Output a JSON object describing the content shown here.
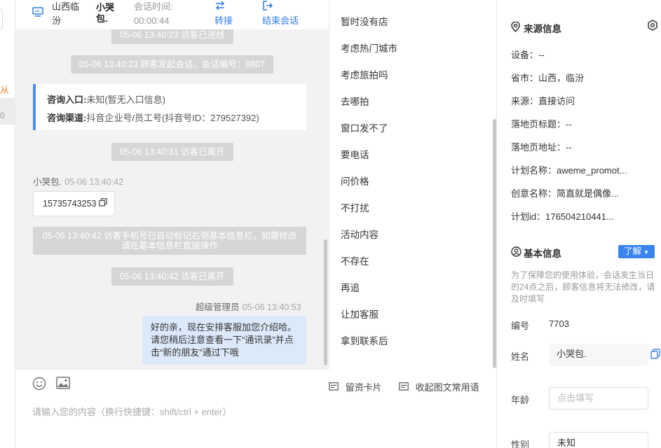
{
  "left_sliver": {
    "orange_text": "从",
    "count_text": "0"
  },
  "header": {
    "location": "山西临汾",
    "visitor_name": "小哭包.",
    "session_time_label": "会话时间:",
    "session_time_value": "00:00:44",
    "transfer_label": "转接",
    "end_label": "结束会话"
  },
  "chat": {
    "sys_top": "05-06 13:40:23 访客已进线",
    "sys_start": "05-06 13:40:23 顾客发起会话，会话编号：9807",
    "entry_label": "咨询入口:",
    "entry_value": "未知(暂无入口信息)",
    "channel_label": "咨询渠道:",
    "channel_value": "抖音企业号/员工号(抖音号ID：279527392)",
    "sys_leave1": "05-06 13:40:31 访客已离开",
    "visitor_name": "小哭包.",
    "visitor_time": "05-06 13:40:42",
    "phone": "15735743253",
    "sys_auto": "05-06 13:40:42 访客手机号已自动标记右侧基本信息栏，如需修改请在基本信息栏直接操作",
    "sys_leave2": "05-06 13:40:42 访客已离开",
    "agent_name": "超级管理员",
    "agent_time": "05-06 13:40:53",
    "agent_message": "好的亲，现在安排客服加您介绍哈。请您稍后注意查看一下“通讯录”并点击“新的朋友”通过下哦"
  },
  "footer": {
    "card_label": "留资卡片",
    "fold_label": "收起图文常用语",
    "input_placeholder": "请输入您的内容（换行快捷键：shift/ctrl + enter）"
  },
  "quick_replies": [
    "暂时没有店",
    "考虑热门城市",
    "考虑旅拍吗",
    "去哪拍",
    "窗口发不了",
    "要电话",
    "问价格",
    "不打扰",
    "活动内容",
    "不存在",
    "再追",
    "让加客服",
    "拿到联系后"
  ],
  "source": {
    "title": "来源信息",
    "device": "设备：--",
    "province": "省市：山西，临汾",
    "source": "来源：直接访问",
    "landing_title": "落地页标题：--",
    "landing_url": "落地页地址：--",
    "plan_name": "计划名称：aweme_promot...",
    "creative_name": "创意名称：简直就是偶像...",
    "plan_id": "计划id：176504210441..."
  },
  "basic": {
    "title": "基本信息",
    "learn_label": "了解",
    "notice": "为了保障您的使用体验，会话发生当日的24点之后，顾客信息将无法修改，请及时填写",
    "id_label": "编号",
    "id_value": "7703",
    "name_label": "姓名",
    "name_value": "小哭包.",
    "age_label": "年龄",
    "age_placeholder": "点击填写",
    "sex_label": "性别",
    "sex_value": "未知"
  }
}
